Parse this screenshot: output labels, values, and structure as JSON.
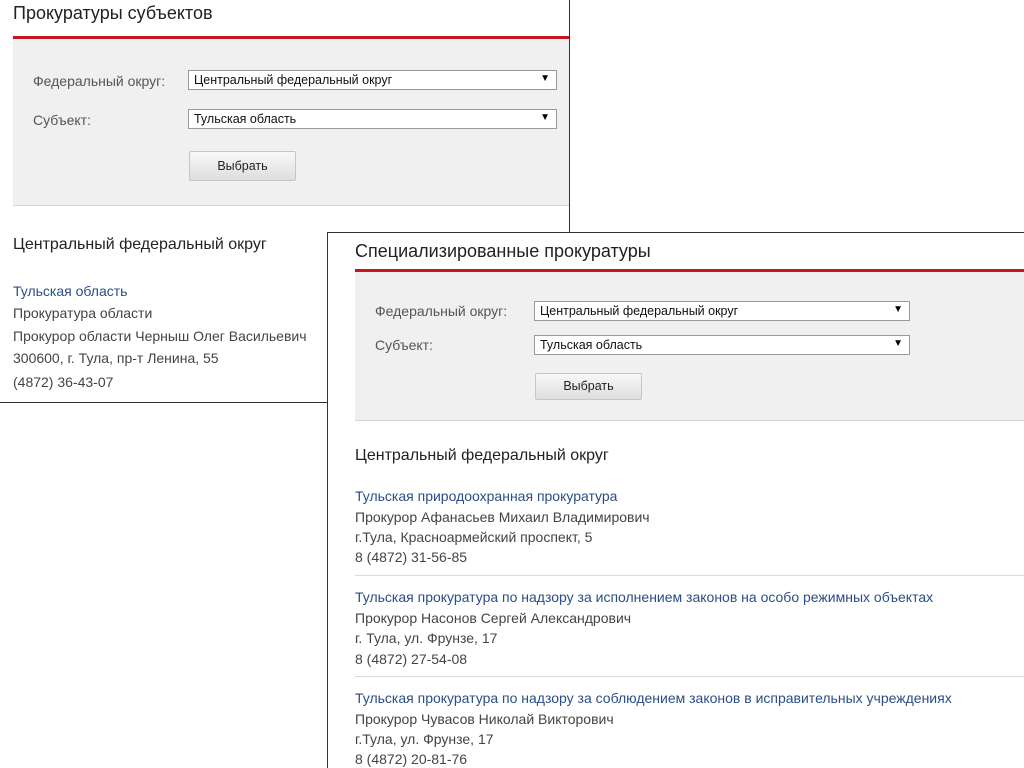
{
  "panel1": {
    "title": "Прокуратуры субъектов",
    "form": {
      "district_label": "Федеральный округ:",
      "district_value": "Центральный федеральный округ",
      "subject_label": "Субъект:",
      "subject_value": "Тульская область",
      "select_button": "Выбрать"
    },
    "section_heading": "Центральный федеральный округ",
    "entry": {
      "name": "Тульская область",
      "type": "Прокуратура области",
      "head": "Прокурор области Черныш Олег Васильевич",
      "address": "300600, г. Тула, пр-т Ленина, 55",
      "phone": "(4872) 36-43-07"
    }
  },
  "panel2": {
    "title": "Специализированные прокуратуры",
    "form": {
      "district_label": "Федеральный округ:",
      "district_value": "Центральный федеральный округ",
      "subject_label": "Субъект:",
      "subject_value": "Тульская область",
      "select_button": "Выбрать"
    },
    "section_heading": "Центральный федеральный округ",
    "entries": [
      {
        "name": "Тульская природоохранная прокуратура",
        "head": "Прокурор Афанасьев Михаил Владимирович",
        "address": "г.Тула, Красноармейский проспект, 5",
        "phone": "8 (4872) 31-56-85"
      },
      {
        "name": "Тульская прокуратура по надзору за исполнением законов на особо режимных объектах",
        "head": "Прокурор Насонов Сергей Александрович",
        "address": "г. Тула, ул. Фрунзе, 17",
        "phone": "8 (4872) 27-54-08"
      },
      {
        "name": "Тульская прокуратура по надзору за соблюдением законов в исправительных учреждениях",
        "head": "Прокурор Чувасов Николай Викторович",
        "address": "г.Тула, ул. Фрунзе, 17",
        "phone": "8 (4872) 20-81-76"
      }
    ]
  },
  "icons": {
    "dropdown": "dropdown-arrow-icon",
    "glyph": "▼"
  },
  "colors": {
    "accent_red": "#c4161c",
    "link_blue": "#2a4e87",
    "form_bg": "#f0f0f0"
  }
}
